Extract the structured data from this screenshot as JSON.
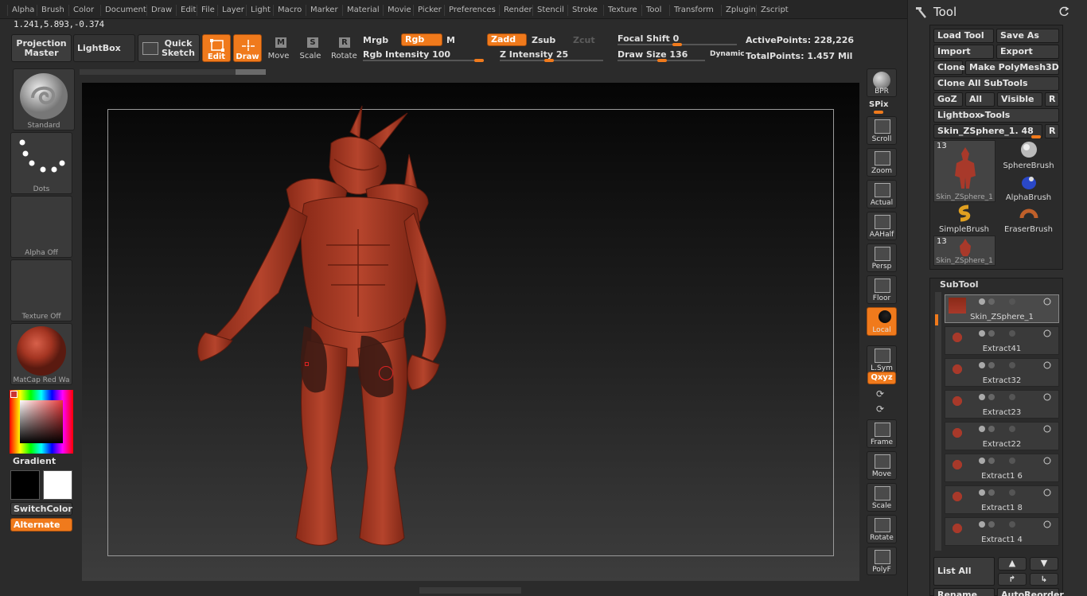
{
  "menu": [
    "Alpha",
    "Brush",
    "Color",
    "Document",
    "Draw",
    "Edit",
    "File",
    "Layer",
    "Light",
    "Macro",
    "Marker",
    "Material",
    "Movie",
    "Picker",
    "Preferences",
    "Render",
    "Stencil",
    "Stroke",
    "Texture",
    "Tool",
    "Transform",
    "Zplugin",
    "Zscript"
  ],
  "coords": "1.241,5.893,-0.374",
  "shelf": {
    "projection_master": "Projection Master",
    "lightbox": "LightBox",
    "quick_sketch": "Quick Sketch",
    "edit": "Edit",
    "draw": "Draw",
    "move": "Move",
    "scale": "Scale",
    "rotate": "Rotate",
    "mrgb": "Mrgb",
    "rgb": "Rgb",
    "m": "M",
    "zadd": "Zadd",
    "zsub": "Zsub",
    "zcut": "Zcut",
    "rgb_intensity_label": "Rgb Intensity",
    "rgb_intensity": "100",
    "z_intensity_label": "Z Intensity",
    "z_intensity": "25",
    "focal_shift_label": "Focal Shift",
    "focal_shift": "0",
    "draw_size_label": "Draw Size",
    "draw_size": "136",
    "dynamic": "Dynamic",
    "active_points_label": "ActivePoints:",
    "active_points": "228,226",
    "total_points_label": "TotalPoints:",
    "total_points": "1.457 Mil"
  },
  "left": {
    "brush": "Standard",
    "stroke": "Dots",
    "alpha": "Alpha  Off",
    "texture": "Texture  Off",
    "material": "MatCap  Red  Wa",
    "gradient": "Gradient",
    "switch_color": "SwitchColor",
    "alternate": "Alternate"
  },
  "right_shelf": [
    {
      "name": "bpr",
      "label": "BPR"
    },
    {
      "name": "spix",
      "label": "SPix"
    },
    {
      "name": "scroll",
      "label": "Scroll"
    },
    {
      "name": "zoom",
      "label": "Zoom"
    },
    {
      "name": "actual",
      "label": "Actual"
    },
    {
      "name": "aahalf",
      "label": "AAHalf"
    },
    {
      "name": "persp",
      "label": "Persp"
    },
    {
      "name": "floor",
      "label": "Floor"
    },
    {
      "name": "local",
      "label": "Local"
    },
    {
      "name": "lsym",
      "label": "L.Sym"
    },
    {
      "name": "xyz",
      "label": "Qxyz"
    },
    {
      "name": "frame",
      "label": "Frame"
    },
    {
      "name": "move",
      "label": "Move"
    },
    {
      "name": "scale",
      "label": "Scale"
    },
    {
      "name": "rotate",
      "label": "Rotate"
    },
    {
      "name": "polyf",
      "label": "PolyF"
    }
  ],
  "tool": {
    "title": "Tool",
    "load_tool": "Load Tool",
    "save_as": "Save As",
    "import": "Import",
    "export": "Export",
    "clone": "Clone",
    "make_polymesh": "Make PolyMesh3D",
    "clone_all": "Clone All SubTools",
    "goz": "GoZ",
    "all": "All",
    "visible": "Visible",
    "r": "R",
    "lightbox_tools": "Lightbox▸Tools",
    "current_tool": "Skin_ZSphere_1. 48",
    "r2": "R",
    "thumbs": [
      {
        "label": "Skin_ZSphere_1",
        "count": "13"
      },
      {
        "label": "SphereBrush",
        "count": ""
      },
      {
        "label": "AlphaBrush",
        "count": ""
      },
      {
        "label": "SimpleBrush",
        "count": ""
      },
      {
        "label": "EraserBrush",
        "count": ""
      },
      {
        "label": "Skin_ZSphere_1",
        "count": "13"
      }
    ],
    "subtool_title": "SubTool",
    "subtools": [
      "Skin_ZSphere_1",
      "Extract41",
      "Extract32",
      "Extract23",
      "Extract22",
      "Extract1 6",
      "Extract1 8",
      "Extract1 4"
    ],
    "list_all": "List All",
    "rename": "Rename",
    "auto_reorder": "AutoReorder"
  }
}
